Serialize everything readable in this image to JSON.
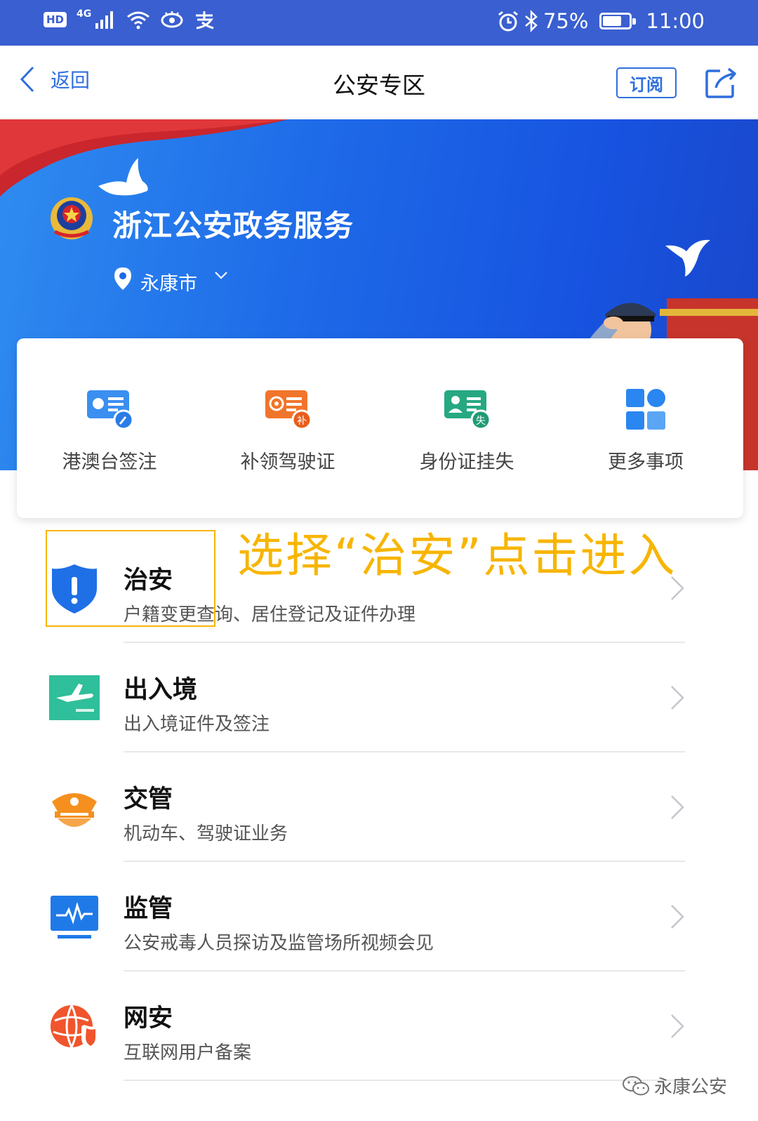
{
  "status_bar": {
    "network": "4G",
    "hd": "HD",
    "battery": "75%",
    "battery_level": 0.75,
    "time": "11:00"
  },
  "nav": {
    "back_label": "返回",
    "title": "公安专区",
    "subscribe_label": "订阅"
  },
  "banner": {
    "brand": "浙江公安政务服务",
    "city": "永康市"
  },
  "quick_actions": [
    {
      "label": "港澳台签注",
      "icon": "hk-macau-taiwan-permit-icon",
      "color": "#3a8ff0"
    },
    {
      "label": "补领驾驶证",
      "icon": "driver-license-reissue-icon",
      "color": "#f0752a"
    },
    {
      "label": "身份证挂失",
      "icon": "id-card-loss-icon",
      "color": "#26a882"
    },
    {
      "label": "更多事项",
      "icon": "more-items-icon",
      "color": "#2a86f0"
    }
  ],
  "annotation": "选择“治安”点击进入",
  "services": [
    {
      "title": "治安",
      "desc": "户籍变更查询、居住登记及证件办理",
      "icon": "shield-icon"
    },
    {
      "title": "出入境",
      "desc": "出入境证件及签注",
      "icon": "airplane-icon"
    },
    {
      "title": "交管",
      "desc": "机动车、驾驶证业务",
      "icon": "police-cap-icon"
    },
    {
      "title": "监管",
      "desc": "公安戒毒人员探访及监管场所视频会见",
      "icon": "monitor-icon"
    },
    {
      "title": "网安",
      "desc": "互联网用户备案",
      "icon": "cyber-security-icon"
    }
  ],
  "watermark": "永康公安",
  "colors": {
    "status_bar": "#3a5fd0",
    "accent": "#2f6fde",
    "annotation": "#f7b500"
  }
}
